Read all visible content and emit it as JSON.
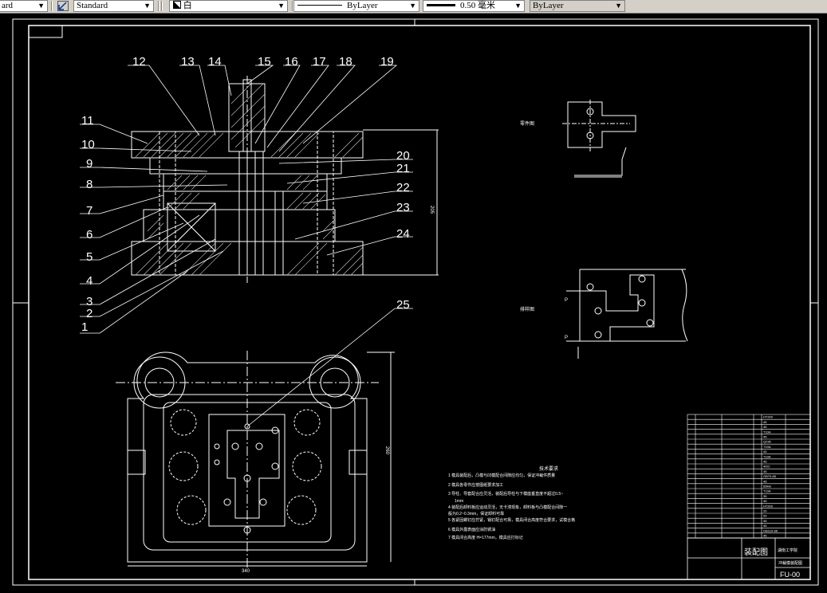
{
  "toolbar": {
    "text_style": "ard",
    "dim_style": "Standard",
    "layer_color_name": "白",
    "linetype": "ByLayer",
    "lineweight": "0.50 毫米",
    "plotstyle": "ByLayer"
  },
  "drawing": {
    "balloons": [
      "1",
      "2",
      "3",
      "4",
      "5",
      "6",
      "7",
      "8",
      "9",
      "10",
      "11",
      "12",
      "13",
      "14",
      "15",
      "16",
      "17",
      "18",
      "19",
      "20",
      "21",
      "22",
      "23",
      "24",
      "25"
    ],
    "dim_height_section": "205",
    "dim_width_plan": "340",
    "dim_height_plan": "260",
    "label_part": "零件图",
    "label_layout": "排样图",
    "dim_layout_a": "P",
    "dim_layout_b": "P",
    "notes_title": "技术要求",
    "notes": [
      "1 模具装配后，凸模与凹模配合间隙应均匀，保证冲裁件质量",
      "2 模具各零件应按图纸要求加工",
      "3 导柱、导套配合应灵活，装配后导柱与下模座垂直度不超过0.5~",
      "1mm",
      "4 装配后卸料板应运动灵活，无卡滞现象，卸料板与凸模配合间隙一",
      "  般为0.2~0.3mm，保证卸料可靠",
      "5 各紧固螺钉应拧紧，销钉配合可靠，模具闭合高度符合要求，试模合格",
      "6 模具外露表面应涂防锈油",
      "7 模具闭合高度 H=177mm，模具应打标记"
    ],
    "title_block": {
      "drawing_name": "装配图",
      "school": "湖南工学院",
      "project": "冲裁模装配图",
      "drawing_no": "FU-00"
    },
    "bom_labels": [
      "HT200",
      "45",
      "45",
      "T10A",
      "45",
      "Q235",
      "T10A",
      "45",
      "T10A",
      "45",
      "40Cr",
      "45",
      "GB70-85",
      "45",
      "65Mn",
      "T10A",
      "35",
      "45",
      "HT200",
      "20",
      "20",
      "45",
      "45",
      "GB119-86",
      "45"
    ]
  }
}
